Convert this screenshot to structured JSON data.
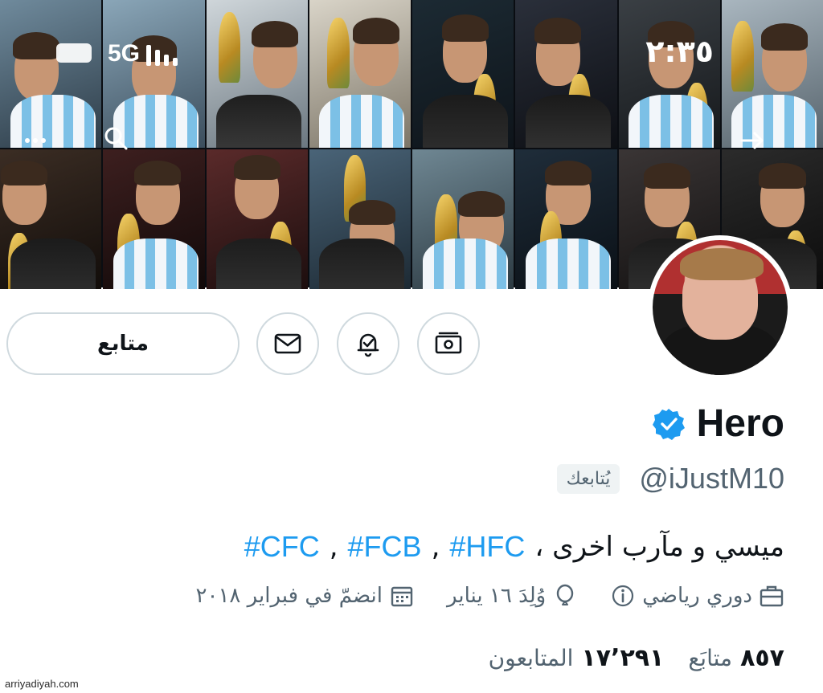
{
  "status_bar": {
    "network": "5G",
    "time": "٢:٣٥"
  },
  "banner": {
    "description_icons": [
      "more-icon",
      "search-icon",
      "arrow-right-icon"
    ]
  },
  "actions": {
    "follow_label": "متابع",
    "message_icon": "envelope-icon",
    "notify_icon": "bell-check-icon",
    "tip_icon": "money-icon"
  },
  "profile": {
    "name": "Hero",
    "verified": true,
    "handle": "@iJustM10",
    "follows_you": "يُتابعك",
    "bio_text": "ميسي و مآرب اخرى ،",
    "bio_tags": [
      "#HFC",
      "#FCB",
      "#CFC"
    ],
    "category": "دوري رياضي",
    "birthday": "وُلِدَ ١٦ يناير",
    "joined": "انضمّ في فبراير ٢٠١٨"
  },
  "counts": {
    "following_num": "٨٥٧",
    "following_label": "متابَع",
    "followers_num": "١٧٬٢٩١",
    "followers_label": "المتابعون"
  },
  "watermark": "arriyadiyah.com",
  "colors": {
    "accent": "#1d9bf0",
    "secondary_text": "#536471",
    "border": "#cfd9de"
  }
}
